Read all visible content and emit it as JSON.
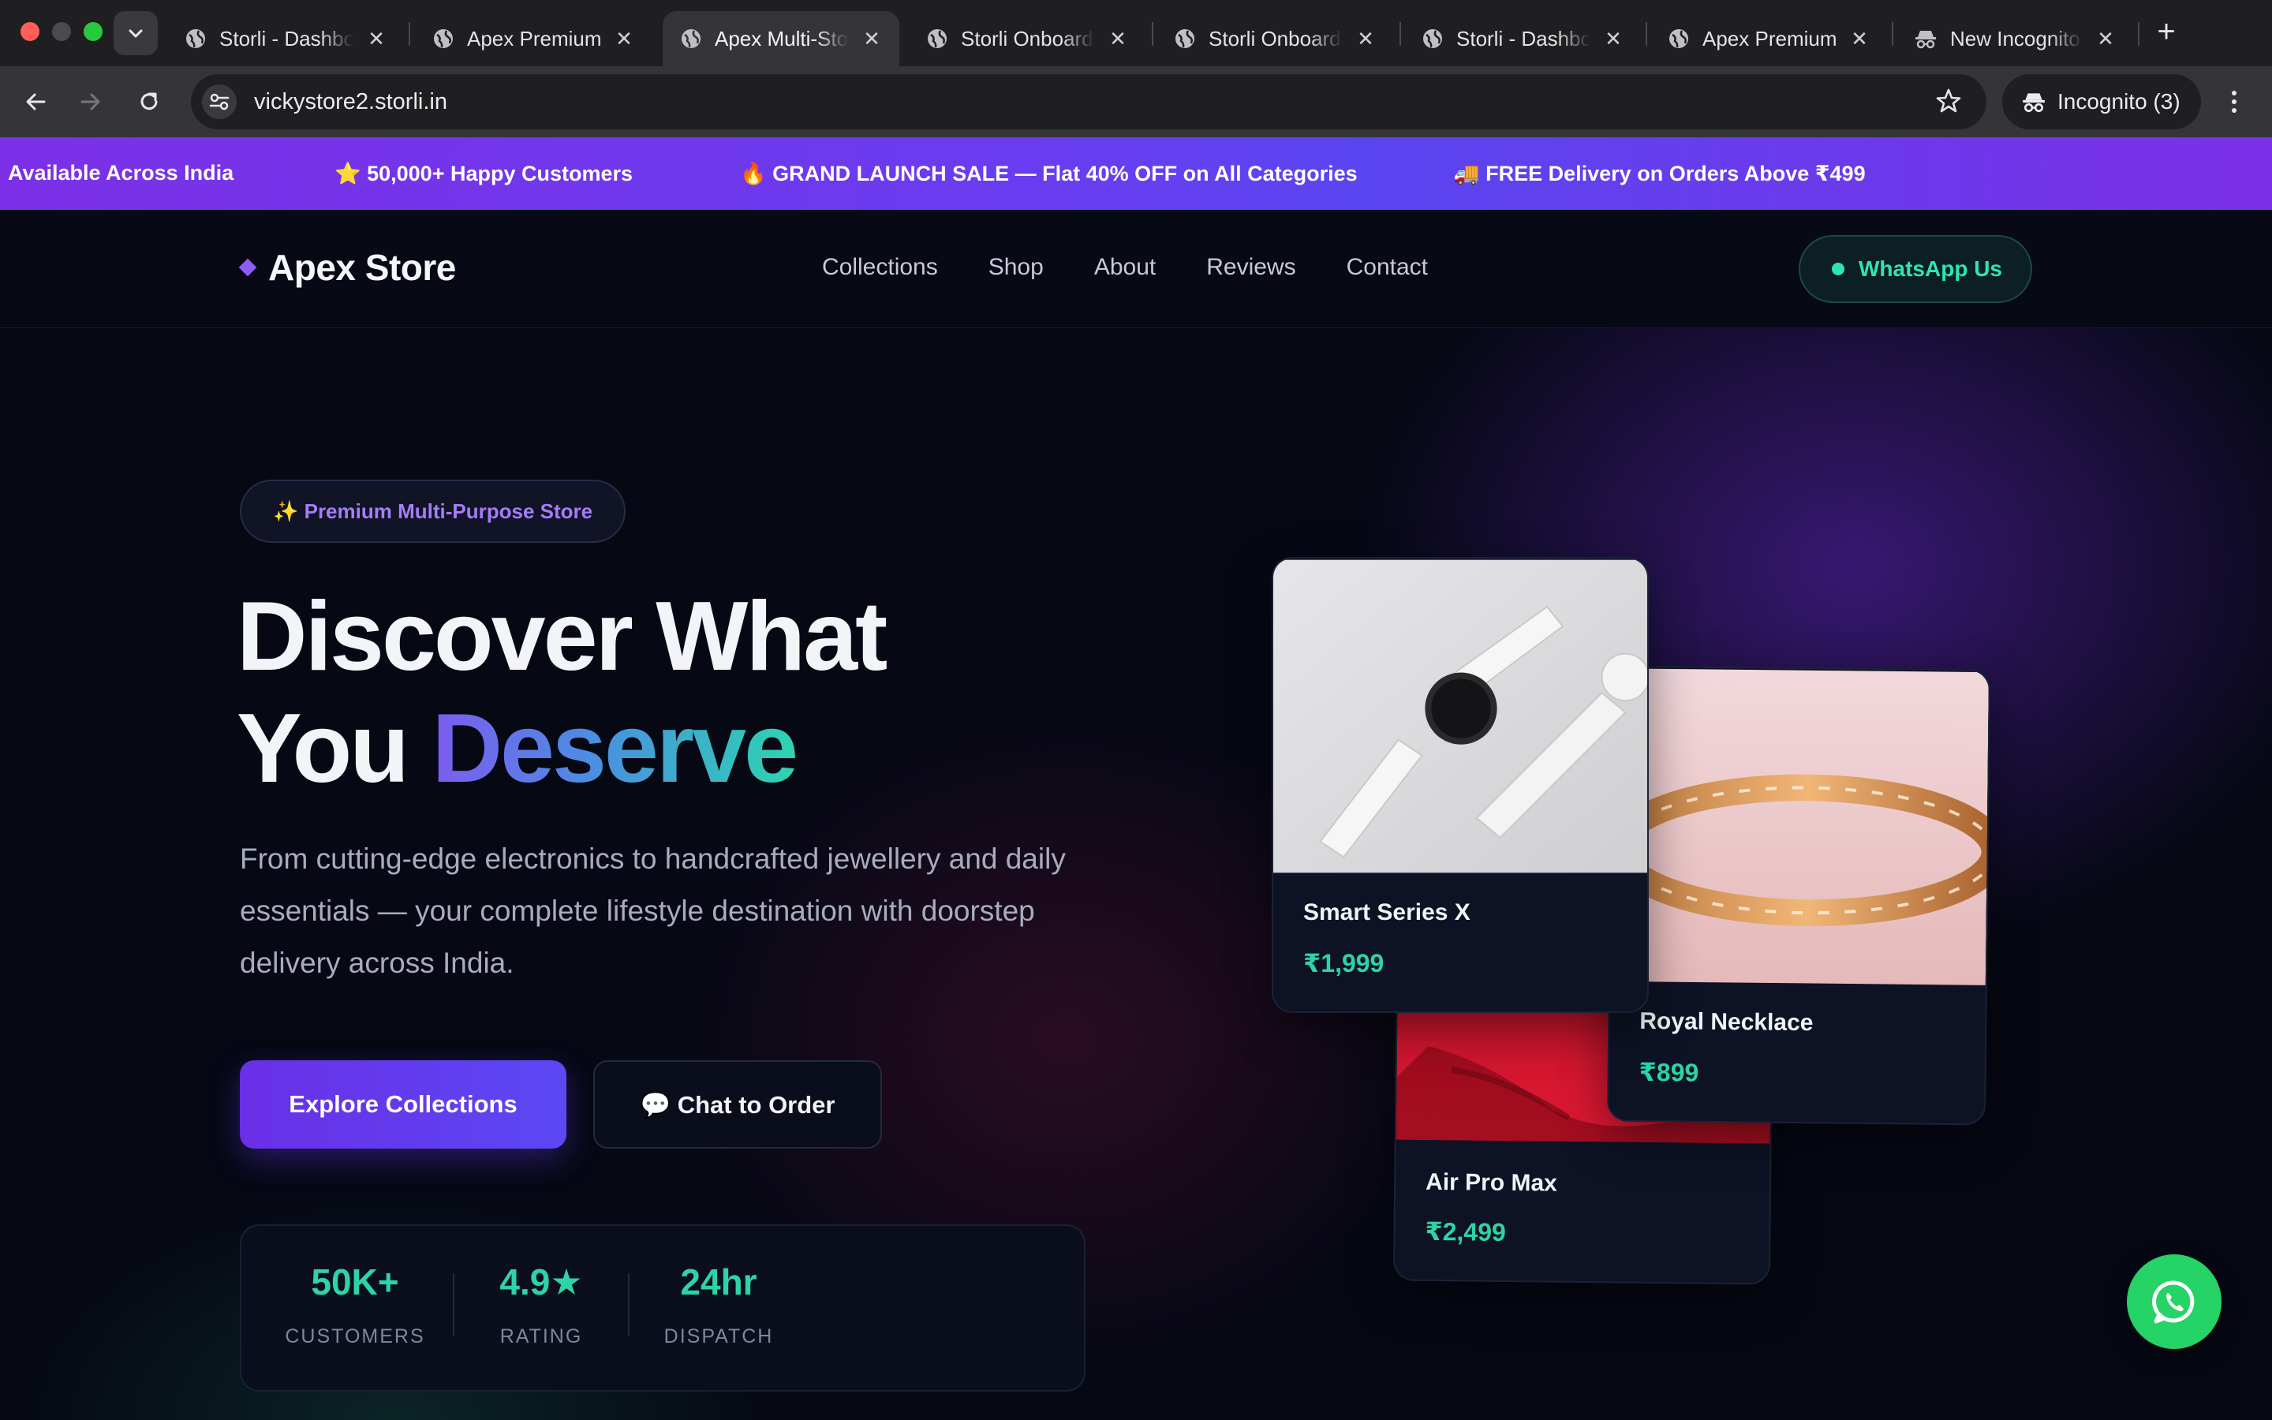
{
  "browser": {
    "tabs": [
      {
        "label": "Storli - Dashboard",
        "active": false,
        "icon": "globe-icon"
      },
      {
        "label": "Apex Premium",
        "active": false,
        "icon": "globe-icon"
      },
      {
        "label": "Apex Multi-Store",
        "active": true,
        "icon": "globe-icon"
      },
      {
        "label": "Storli Onboarding",
        "active": false,
        "icon": "globe-icon"
      },
      {
        "label": "Storli Onboarding",
        "active": false,
        "icon": "globe-icon"
      },
      {
        "label": "Storli - Dashboard",
        "active": false,
        "icon": "globe-icon"
      },
      {
        "label": "Apex Premium",
        "active": false,
        "icon": "globe-icon"
      },
      {
        "label": "New Incognito",
        "active": false,
        "icon": "incognito-icon"
      }
    ],
    "url": "vickystore2.storli.in",
    "incognito_label": "Incognito (3)"
  },
  "announcement": {
    "items": [
      "Available Across India",
      "⭐ 50,000+ Happy Customers",
      "🔥 GRAND LAUNCH SALE — Flat 40% OFF on All Categories",
      "🚚 FREE Delivery on Orders Above ₹499"
    ]
  },
  "header": {
    "logo": "Apex Store",
    "nav": [
      "Collections",
      "Shop",
      "About",
      "Reviews",
      "Contact"
    ],
    "whatsapp_label": "WhatsApp Us"
  },
  "hero": {
    "badge": "✨ Premium Multi-Purpose Store",
    "title_line1": "Discover What",
    "title_line2_plain": "You ",
    "title_line2_accent": "Deserve",
    "subtitle": "From cutting-edge electronics to handcrafted jewellery and daily essentials — your complete lifestyle destination with doorstep delivery across India.",
    "primary_cta": "Explore Collections",
    "secondary_cta": "💬 Chat to Order",
    "stats": [
      {
        "value": "50K+",
        "label": "CUSTOMERS"
      },
      {
        "value": "4.9★",
        "label": "RATING"
      },
      {
        "value": "24hr",
        "label": "DISPATCH"
      }
    ]
  },
  "products": [
    {
      "name": "Smart Series X",
      "price": "₹1,999"
    },
    {
      "name": "Royal Necklace",
      "price": "₹899"
    },
    {
      "name": "Air Pro Max",
      "price": "₹2,499"
    }
  ],
  "colors": {
    "accent_purple": "#7b30e6",
    "accent_green": "#2ed3a6",
    "whatsapp_green": "#25d366",
    "background": "#060814"
  }
}
